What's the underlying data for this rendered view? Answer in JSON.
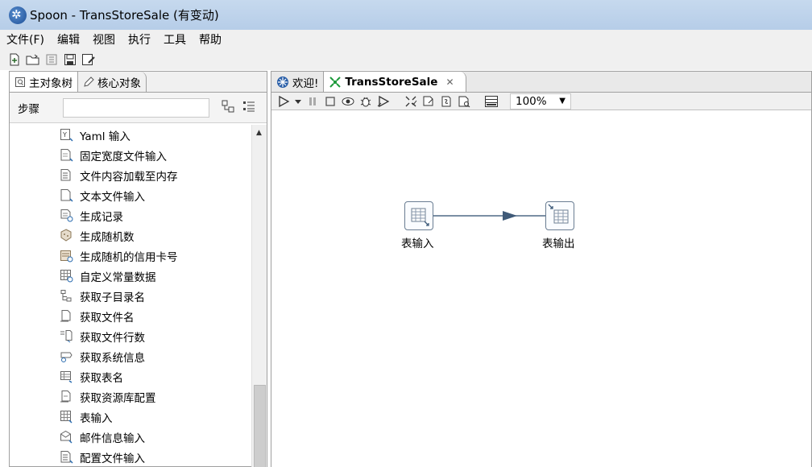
{
  "window": {
    "title": "Spoon - TransStoreSale (有变动)"
  },
  "menu": [
    "文件(F)",
    "编辑",
    "视图",
    "执行",
    "工具",
    "帮助"
  ],
  "toolbar": {
    "icons": [
      "new-file-icon",
      "open-folder-icon",
      "explore-repo-icon",
      "save-icon",
      "save-as-icon"
    ]
  },
  "left_panel": {
    "tabs": [
      "主对象树",
      "核心对象"
    ],
    "steps_label": "步骤",
    "search_value": "",
    "tree_items": [
      "Yaml 输入",
      "固定宽度文件输入",
      "文件内容加载至内存",
      "文本文件输入",
      "生成记录",
      "生成随机数",
      "生成随机的信用卡号",
      "自定义常量数据",
      "获取子目录名",
      "获取文件名",
      "获取文件行数",
      "获取系统信息",
      "获取表名",
      "获取资源库配置",
      "表输入",
      "邮件信息输入",
      "配置文件输入"
    ]
  },
  "right_panel": {
    "tabs": [
      {
        "label": "欢迎!"
      },
      {
        "label": "TransStoreSale"
      }
    ],
    "zoom": "100%",
    "canvas": {
      "nodes": [
        {
          "label": "表输入"
        },
        {
          "label": "表输出"
        }
      ]
    }
  }
}
